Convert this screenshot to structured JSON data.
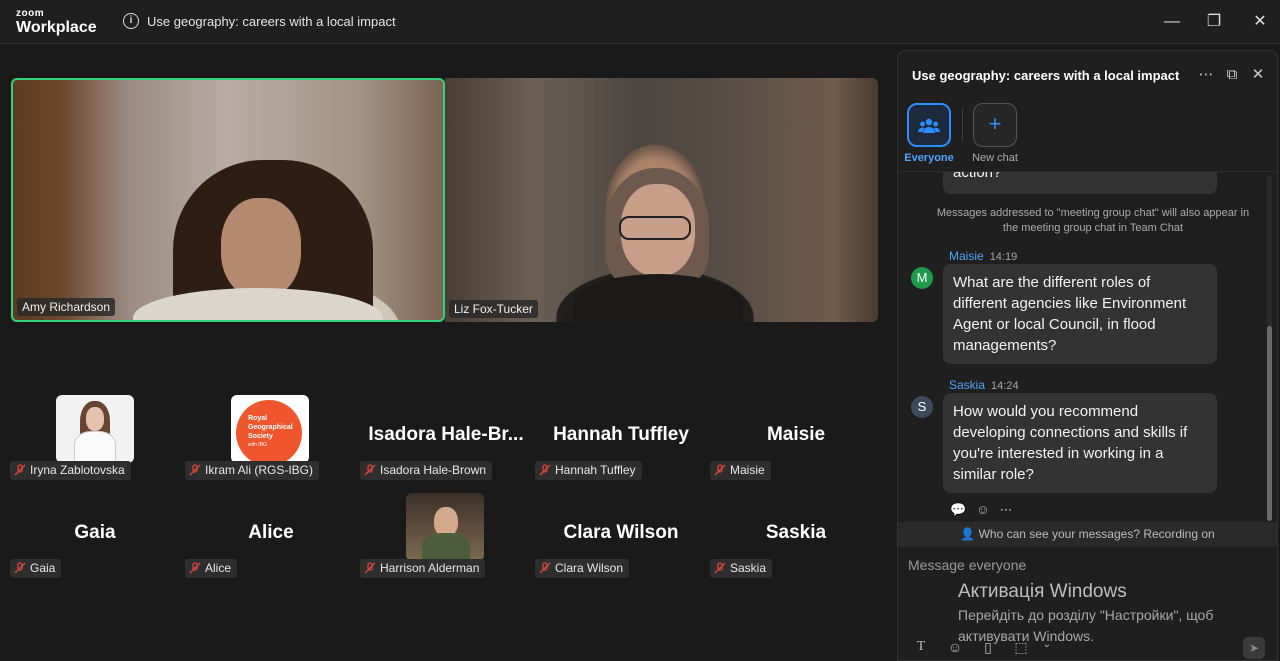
{
  "app": {
    "brand_small": "zoom",
    "brand_name": "Workplace"
  },
  "meeting": {
    "topic": "Use geography: careers with a local impact"
  },
  "window_controls": {
    "minimize": "—",
    "restore": "❐",
    "close": "✕"
  },
  "speakers": [
    {
      "name": "Amy Richardson"
    },
    {
      "name": "Liz Fox-Tucker"
    }
  ],
  "gallery": [
    {
      "name": "Iryna Zablotovska",
      "display": "",
      "muted": true
    },
    {
      "name": "Ikram Ali (RGS-IBG)",
      "display": "",
      "muted": true
    },
    {
      "name": "Isadora Hale-Brown",
      "display": "Isadora  Hale-Br...",
      "muted": true
    },
    {
      "name": "Hannah Tuffley",
      "display": "Hannah Tuffley",
      "muted": true
    },
    {
      "name": "Maisie",
      "display": "Maisie",
      "muted": true
    },
    {
      "name": "Gaia",
      "display": "Gaia",
      "muted": true
    },
    {
      "name": "Alice",
      "display": "Alice",
      "muted": true
    },
    {
      "name": "Harrison Alderman",
      "display": "",
      "muted": true
    },
    {
      "name": "Clara Wilson",
      "display": "Clara Wilson",
      "muted": true
    },
    {
      "name": "Saskia",
      "display": "Saskia",
      "muted": true
    }
  ],
  "rgs_logo": {
    "line1": "Royal",
    "line2": "Geographical",
    "line3": "Society",
    "line4": "with IBG"
  },
  "chat": {
    "title": "Use geography: careers with a local impact",
    "tabs": {
      "everyone": "Everyone",
      "new_chat": "New chat"
    },
    "prev_tail": "action?",
    "notice": "Messages addressed to \"meeting group chat\" will also appear in the meeting group chat in Team Chat",
    "messages": [
      {
        "sender": "Maisie",
        "time": "14:19",
        "initial": "M",
        "text": "What are the different roles of different agencies like Environment Agent or local Council, in flood managements?"
      },
      {
        "sender": "Saskia",
        "time": "14:24",
        "initial": "S",
        "text": "How would you recommend developing connections and skills if you're interested in working in a similar role?"
      }
    ],
    "privacy": "Who can see your messages? Recording on",
    "compose_placeholder": "Message everyone"
  },
  "watermark": {
    "title": "Активація Windows",
    "subtitle": "Перейдіть до розділу \"Настройки\", щоб активувати Windows."
  },
  "colors": {
    "active_speaker": "#2fd47a",
    "accent": "#2d8cff",
    "maisie_avatar": "#1f9a4a",
    "saskia_avatar": "#3c4a5e"
  }
}
